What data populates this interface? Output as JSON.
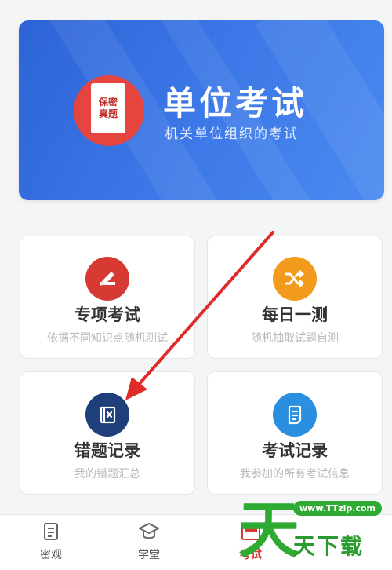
{
  "banner": {
    "badge_line1": "保密",
    "badge_line2": "真题",
    "title": "单位考试",
    "subtitle": "机关单位组织的考试"
  },
  "cards": [
    {
      "title": "专项考试",
      "desc": "依据不同知识点随机测试",
      "icon": "pencil-book-icon",
      "color": "#d63a33"
    },
    {
      "title": "每日一测",
      "desc": "随机抽取试题自测",
      "icon": "shuffle-icon",
      "color": "#f29a1c"
    },
    {
      "title": "错题记录",
      "desc": "我的错题汇总",
      "icon": "wrong-book-icon",
      "color": "#1f3f7a"
    },
    {
      "title": "考试记录",
      "desc": "我参加的所有考试信息",
      "icon": "document-list-icon",
      "color": "#2a8fe0"
    }
  ],
  "tabbar": {
    "tabs": [
      {
        "label": "密观",
        "icon": "news-icon"
      },
      {
        "label": "学堂",
        "icon": "graduation-cap-icon"
      },
      {
        "label": "考试",
        "icon": "exam-icon",
        "active": true
      }
    ]
  },
  "watermark": {
    "url": "www.TTzip.com",
    "big_char": "天",
    "text": "天下载"
  },
  "colors": {
    "accent_red": "#d63a33",
    "banner_blue": "#3b76e6"
  }
}
